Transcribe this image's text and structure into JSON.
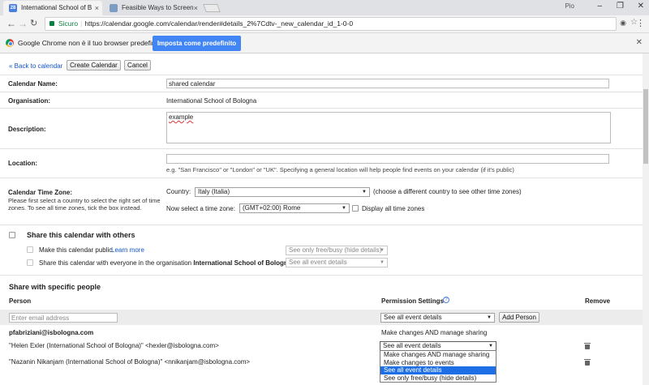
{
  "browser": {
    "tabs": [
      {
        "title": "International School of B",
        "icon": "calendar-28-icon",
        "icon_text": "28"
      },
      {
        "title": "Feasible Ways to Screen",
        "icon": "page-icon"
      }
    ],
    "user_label": "Pio",
    "address": {
      "secure_label": "Sicuro",
      "url": "https://calendar.google.com/calendar/render#details_2%7Cdtv-_new_calendar_id_1-0-0"
    },
    "infobar": {
      "message": "Google Chrome non è il tuo browser predefinito.",
      "button": "Imposta come predefinito"
    }
  },
  "toolbar": {
    "back_label": "« Back to calendar",
    "create_label": "Create Calendar",
    "cancel_label": "Cancel"
  },
  "form": {
    "calendar_name": {
      "label": "Calendar Name:",
      "value": "shared calendar"
    },
    "organisation": {
      "label": "Organisation:",
      "value": "International School of Bologna"
    },
    "description": {
      "label": "Description:",
      "value": "example"
    },
    "location": {
      "label": "Location:",
      "value": "",
      "hint": "e.g. \"San Francisco\" or \"London\" or \"UK\". Specifying a general location will help people find events on your calendar (if it's public)"
    },
    "time_zone": {
      "label": "Calendar Time Zone:",
      "desc_line1": "Please first select a country to select the right set of time",
      "desc_line2": "zones. To see all time zones, tick the box instead.",
      "country_label": "Country:",
      "country_value": "Italy (Italia)",
      "country_hint": "(choose a different country to see other time zones)",
      "tz_label": "Now select a time zone:",
      "tz_value": "(GMT+02:00) Rome",
      "all_tz_label": "Display all time zones"
    }
  },
  "sharing": {
    "title": "Share this calendar with others",
    "public_label": "Make this calendar public",
    "learn_more": "Learn more",
    "public_select": "See only free/busy (hide details)",
    "org_label_prefix": "Share this calendar with everyone in the organisation",
    "org_name": "International School of Bologna",
    "org_select": "See all event details"
  },
  "people": {
    "title": "Share with specific people",
    "col_person": "Person",
    "col_permission": "Permission Settings",
    "col_remove": "Remove",
    "email_placeholder": "Enter email address",
    "add_permission": "See all event details",
    "add_button": "Add Person",
    "rows": [
      {
        "person": "pfabriziani@isbologna.com",
        "permission": "Make changes AND manage sharing"
      },
      {
        "person": "\"Helen Exler (International School of Bologna)\" <hexler@isbologna.com>",
        "permission": "See all event details"
      },
      {
        "person": "\"Nazanin Nikanjam (International School of Bologna)\" <nnikanjam@isbologna.com>",
        "permission": "See all event details"
      }
    ],
    "dropdown_options": [
      "Make changes AND manage sharing",
      "Make changes to events",
      "See all event details",
      "See only free/busy (hide details)"
    ],
    "dropdown_selected": "See all event details"
  }
}
